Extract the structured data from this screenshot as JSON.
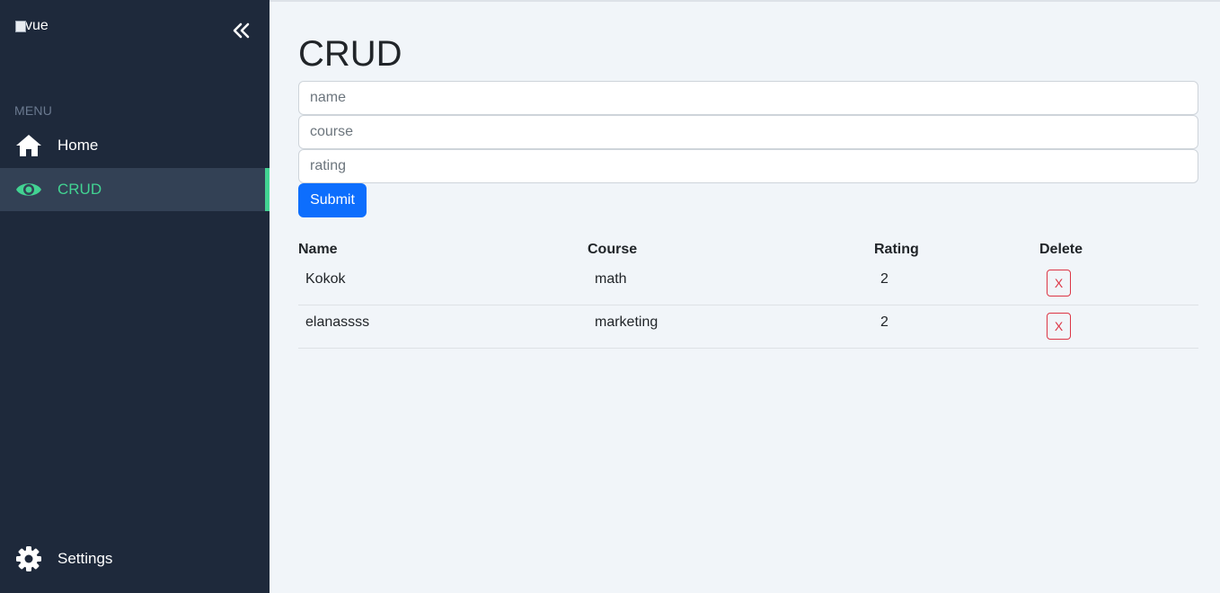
{
  "sidebar": {
    "logo_alt": "vue",
    "collapse_icon": "double-chevron-left-icon",
    "menu_label": "MENU",
    "items": [
      {
        "label": "Home",
        "icon": "home-icon"
      },
      {
        "label": "CRUD",
        "icon": "eye-icon",
        "active": true
      },
      {
        "label": "Settings",
        "icon": "gear-icon"
      }
    ],
    "colors": {
      "background": "#1e293b",
      "active_bg": "#334155",
      "accent": "#42d392"
    }
  },
  "main": {
    "title": "CRUD",
    "form": {
      "name_placeholder": "name",
      "course_placeholder": "course",
      "rating_placeholder": "rating",
      "name_value": "",
      "course_value": "",
      "rating_value": "",
      "submit_label": "Submit"
    },
    "table": {
      "headers": [
        "Name",
        "Course",
        "Rating",
        "Delete"
      ],
      "rows": [
        {
          "name": "Kokok",
          "course": "math",
          "rating": "2",
          "delete_label": "X"
        },
        {
          "name": "elanassss",
          "course": "marketing",
          "rating": "2",
          "delete_label": "X"
        }
      ]
    },
    "colors": {
      "primary": "#0d6efd",
      "danger": "#dc3545"
    }
  }
}
